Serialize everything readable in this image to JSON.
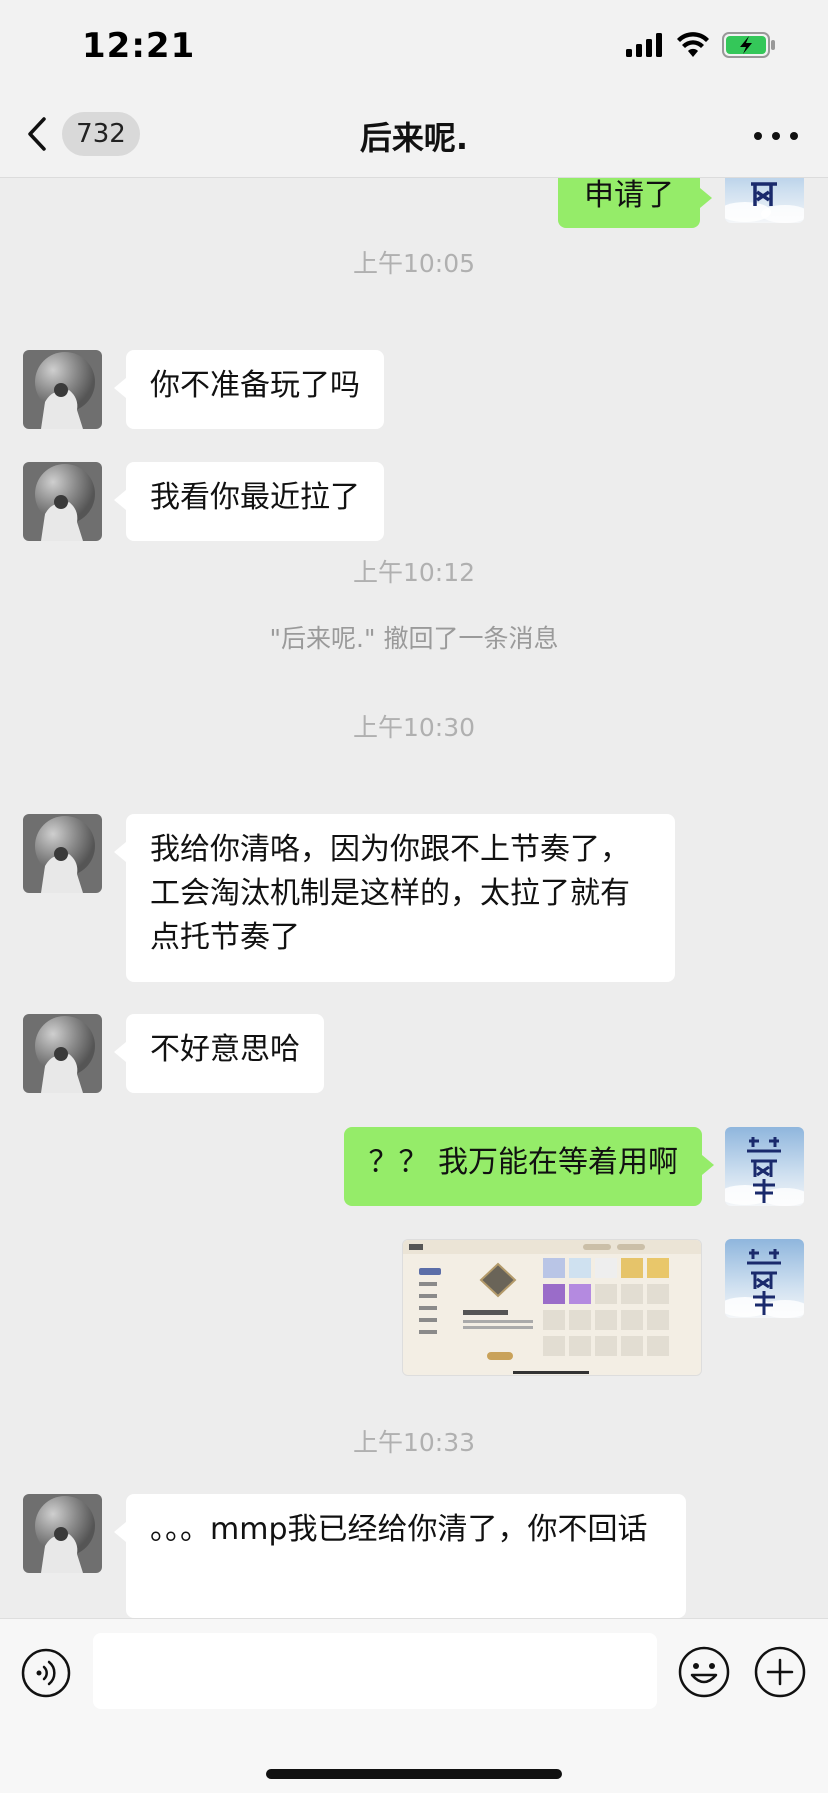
{
  "status_bar": {
    "time": "12:21",
    "battery_charging": true
  },
  "nav": {
    "unread_count": "732",
    "title": "后来呢."
  },
  "messages": {
    "m0": {
      "side": "out",
      "text": "申请了"
    },
    "t1": "上午10:05",
    "m1": {
      "side": "in",
      "text": "你不准备玩了吗"
    },
    "m2": {
      "side": "in",
      "text": "我看你最近拉了"
    },
    "t2": "上午10:12",
    "sys1": "\"后来呢.\" 撤回了一条消息",
    "t3": "上午10:30",
    "m3": {
      "side": "in",
      "text": "我给你清咯，因为你跟不上节奏了，工会淘汰机制是这样的，太拉了就有点托节奏了"
    },
    "m4": {
      "side": "in",
      "text": "不好意思哈"
    },
    "m5": {
      "side": "out",
      "text": "？？ 我万能在等着用啊"
    },
    "m6": {
      "side": "out",
      "type": "image",
      "description_icon": "game-inventory-screenshot"
    },
    "t4": "上午10:33",
    "m7": {
      "side": "in",
      "text": "。。。mmp我已经给你清了，你不回话"
    }
  },
  "my_avatar": {
    "text": "等风来"
  },
  "input_bar": {
    "placeholder": ""
  },
  "colors": {
    "out_bubble": "#95ec69",
    "in_bubble": "#ffffff",
    "background": "#ededed"
  }
}
